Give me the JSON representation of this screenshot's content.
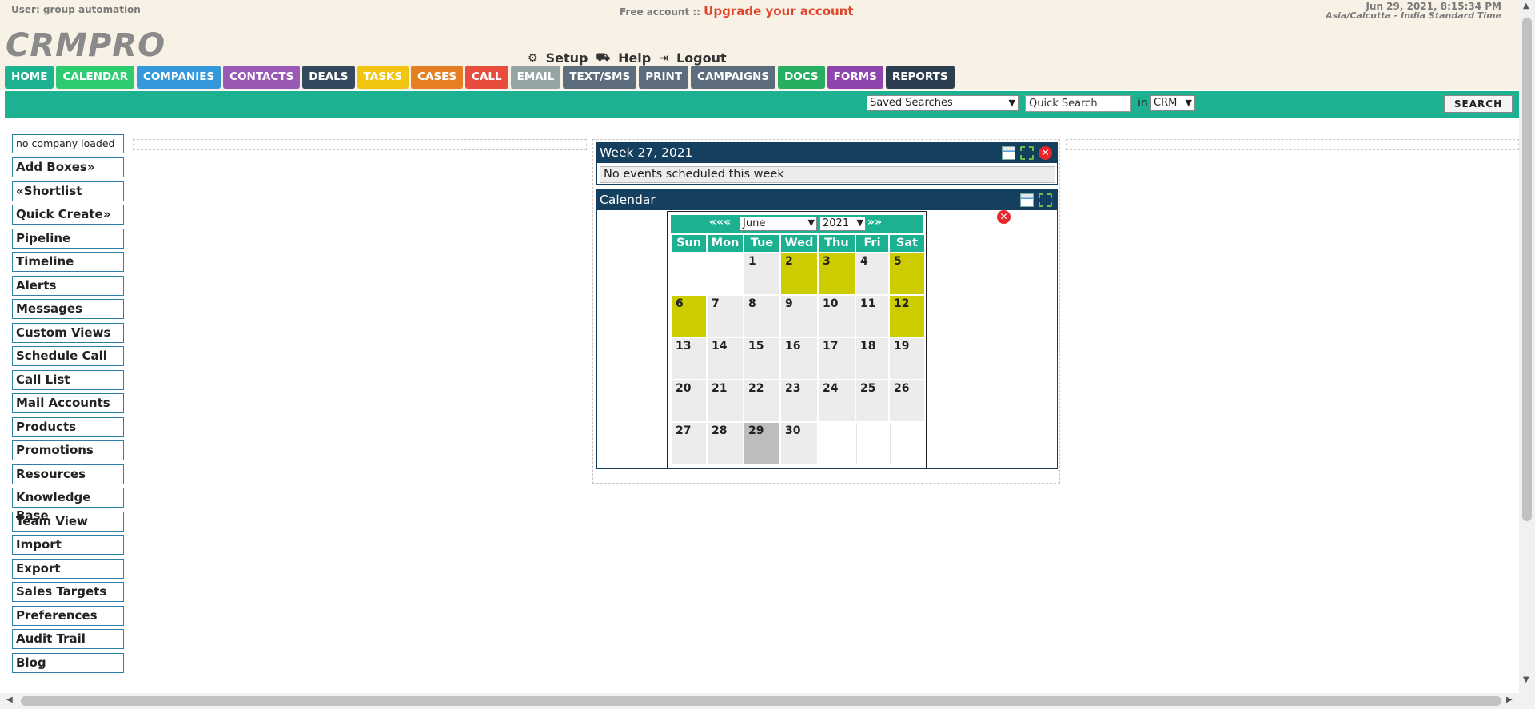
{
  "header": {
    "user_label": "User: group automation",
    "free_account": "Free account ::",
    "upgrade_link": "Upgrade your account",
    "datetime": "Jun 29, 2021, 8:15:34 PM",
    "timezone": "Asia/Calcutta - India Standard Time",
    "logo": "CRMPRO",
    "links": {
      "setup": "Setup",
      "help": "Help",
      "logout": "Logout"
    }
  },
  "nav": [
    {
      "label": "HOME",
      "color": "#1bb191"
    },
    {
      "label": "CALENDAR",
      "color": "#2ecc71"
    },
    {
      "label": "COMPANIES",
      "color": "#3498db"
    },
    {
      "label": "CONTACTS",
      "color": "#9b59b6"
    },
    {
      "label": "DEALS",
      "color": "#34495e"
    },
    {
      "label": "TASKS",
      "color": "#f1c40f"
    },
    {
      "label": "CASES",
      "color": "#e67e22"
    },
    {
      "label": "CALL",
      "color": "#e74c3c"
    },
    {
      "label": "EMAIL",
      "color": "#95a5a6"
    },
    {
      "label": "TEXT/SMS",
      "color": "#5d6d7e"
    },
    {
      "label": "PRINT",
      "color": "#5d6d7e"
    },
    {
      "label": "CAMPAIGNS",
      "color": "#5d6d7e"
    },
    {
      "label": "DOCS",
      "color": "#27ae60"
    },
    {
      "label": "FORMS",
      "color": "#8e44ad"
    },
    {
      "label": "REPORTS",
      "color": "#2c3e50"
    }
  ],
  "search": {
    "saved_searches": "Saved Searches",
    "quick_search_placeholder": "Quick Search",
    "in_label": "in",
    "scope": "CRM",
    "button": "SEARCH"
  },
  "sidebar": {
    "company_loaded": "no company loaded",
    "items": [
      "Add Boxes»",
      "«Shortlist",
      "Quick Create»",
      "Pipeline",
      "Timeline",
      "Alerts",
      "Messages",
      "Custom Views",
      "Schedule Call",
      "Call List",
      "Mail Accounts",
      "Products",
      "Promotions",
      "Resources",
      "Knowledge Base",
      "Team View",
      "Import",
      "Export",
      "Sales Targets",
      "Preferences",
      "Audit Trail",
      "Blog"
    ]
  },
  "week_panel": {
    "title": "Week 27, 2021",
    "no_events": "No events scheduled this week"
  },
  "calendar_panel": {
    "title": "Calendar",
    "prev": "«««",
    "next": "»»",
    "month": "June",
    "year": "2021",
    "days_of_week": [
      "Sun",
      "Mon",
      "Tue",
      "Wed",
      "Thu",
      "Fri",
      "Sat"
    ],
    "weeks": [
      [
        {
          "d": ""
        },
        {
          "d": ""
        },
        {
          "d": "1"
        },
        {
          "d": "2",
          "hl": true
        },
        {
          "d": "3",
          "hl": true
        },
        {
          "d": "4"
        },
        {
          "d": "5",
          "hl": true
        }
      ],
      [
        {
          "d": "6",
          "hl": true
        },
        {
          "d": "7"
        },
        {
          "d": "8"
        },
        {
          "d": "9"
        },
        {
          "d": "10"
        },
        {
          "d": "11"
        },
        {
          "d": "12",
          "hl": true
        }
      ],
      [
        {
          "d": "13"
        },
        {
          "d": "14"
        },
        {
          "d": "15"
        },
        {
          "d": "16"
        },
        {
          "d": "17"
        },
        {
          "d": "18"
        },
        {
          "d": "19"
        }
      ],
      [
        {
          "d": "20"
        },
        {
          "d": "21"
        },
        {
          "d": "22"
        },
        {
          "d": "23"
        },
        {
          "d": "24"
        },
        {
          "d": "25"
        },
        {
          "d": "26"
        }
      ],
      [
        {
          "d": "27"
        },
        {
          "d": "28"
        },
        {
          "d": "29",
          "today": true
        },
        {
          "d": "30"
        },
        {
          "d": ""
        },
        {
          "d": ""
        },
        {
          "d": ""
        }
      ]
    ]
  }
}
